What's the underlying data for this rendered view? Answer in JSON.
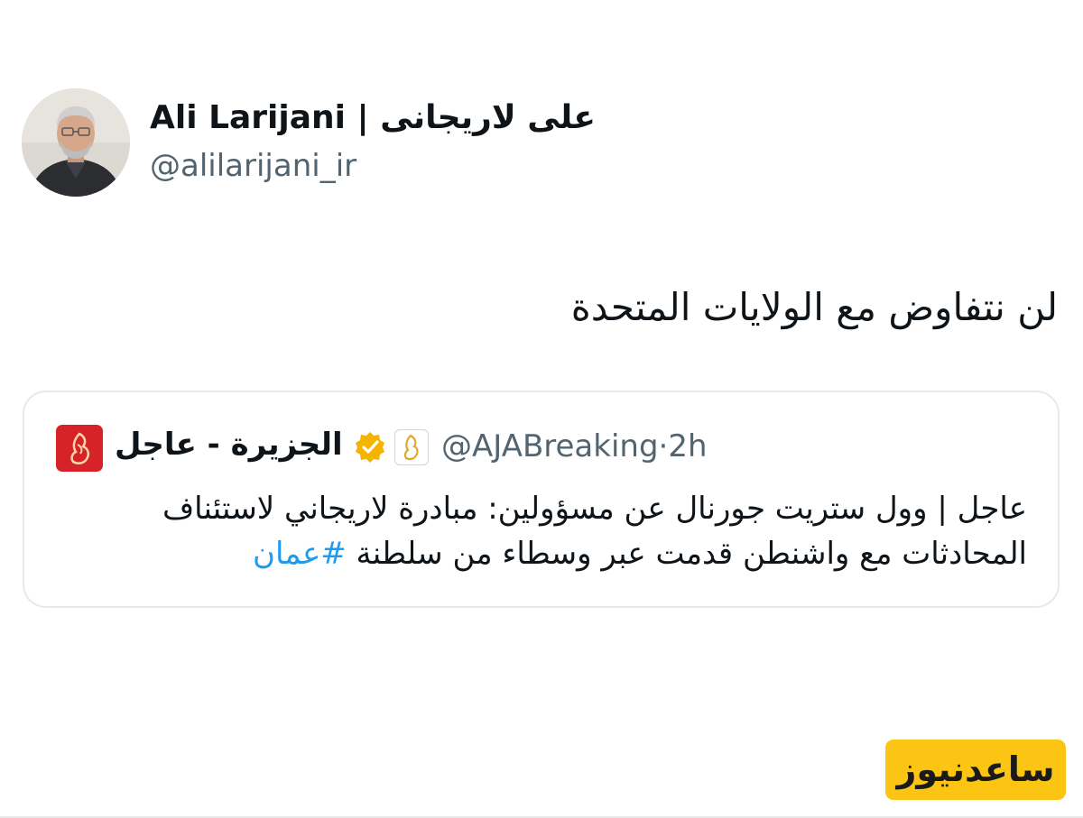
{
  "author": {
    "display_name": "Ali Larijani | علی لاریجانی",
    "handle": "@alilarijani_ir",
    "avatar_icon": "profile-photo"
  },
  "tweet": {
    "text": "لن نتفاوض مع الولايات المتحدة"
  },
  "quoted_tweet": {
    "source_name": "الجزيرة - عاجل",
    "handle": "@AJABreaking",
    "separator": "·",
    "time": "2h",
    "verified_color": "#f4b400",
    "logo_color": "#d7222a",
    "body_line_1": "عاجل | وول ستريت جورنال عن مسؤولين: مبادرة لاريجاني لاستئناف",
    "body_line_2": "المحادثات مع واشنطن قدمت عبر وسطاء من سلطنة",
    "hashtag": "#عمان",
    "hashtag_color": "#1d9bf0"
  },
  "watermark": {
    "text": "ساعدنیوز",
    "background": "#fdc513"
  }
}
